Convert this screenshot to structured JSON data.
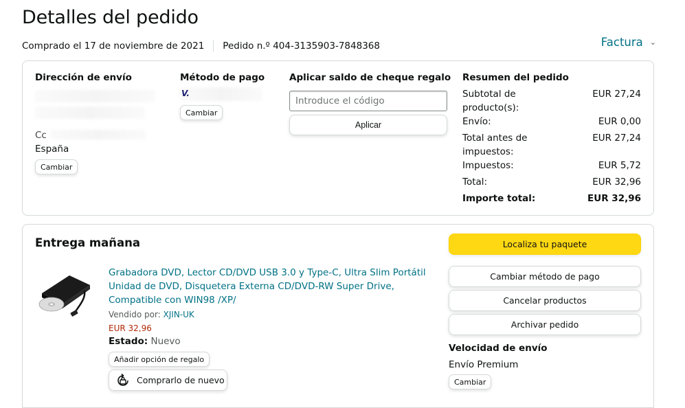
{
  "page": {
    "title": "Detalles del pedido",
    "purchased": "Comprado el 17 de noviembre de 2021",
    "order_number": "Pedido n.º 404-3135903-7848368",
    "invoice_label": "Factura"
  },
  "shipping": {
    "heading": "Dirección de envío",
    "partial_line": "Cc",
    "country": "España",
    "change_label": "Cambiar"
  },
  "payment": {
    "heading": "Método de pago",
    "card_brand": "V.",
    "change_label": "Cambiar"
  },
  "gift_card": {
    "heading": "Aplicar saldo de cheque regalo",
    "placeholder": "Introduce el código",
    "apply_label": "Aplicar"
  },
  "summary": {
    "heading": "Resumen del pedido",
    "rows": [
      {
        "label": "Subtotal de producto(s):",
        "value": "EUR 27,24"
      },
      {
        "label": "Envío:",
        "value": "EUR 0,00"
      },
      {
        "label": "Total antes de impuestos:",
        "value": "EUR 27,24"
      },
      {
        "label": "Impuestos:",
        "value": "EUR 5,72"
      },
      {
        "label": "Total:",
        "value": "EUR 32,96"
      },
      {
        "label": "Importe total:",
        "value": "EUR 32,96"
      }
    ]
  },
  "delivery": {
    "heading": "Entrega mañana",
    "product_title": "Grabadora DVD, Lector CD/DVD USB 3.0 y Type-C, Ultra Slim Portátil Unidad de DVD, Disquetera Externa CD/DVD-RW Super Drive, Compatible con WIN98 /XP/",
    "seller_prefix": "Vendido por:",
    "seller_name": "XJIN-UK",
    "price": "EUR 32,96",
    "state_label": "Estado:",
    "state_value": "Nuevo",
    "gift_option_label": "Añadir opción de regalo",
    "buy_again_label": "Comprarlo de nuevo",
    "track_label": "Localiza tu paquete",
    "change_payment_label": "Cambiar método de pago",
    "cancel_label": "Cancelar productos",
    "archive_label": "Archivar pedido",
    "speed_heading": "Velocidad de envío",
    "speed_value": "Envío Premium",
    "speed_change_label": "Cambiar"
  },
  "colors": {
    "link": "#007185",
    "price": "#b12704",
    "primary_button": "#ffd814",
    "border": "#d5d9d9"
  }
}
